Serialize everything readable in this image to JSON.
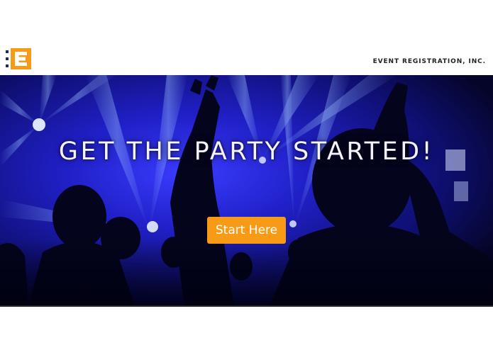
{
  "header": {
    "logo_icon": "event-e-logo",
    "company_name": "EVENT REGISTRATION, INC."
  },
  "hero": {
    "title": "GET THE PARTY STARTED!",
    "cta_label": "Start Here"
  },
  "colors": {
    "accent": "#f79a16",
    "hero_background": "#1a1ab4",
    "header_background": "#ffffff"
  }
}
